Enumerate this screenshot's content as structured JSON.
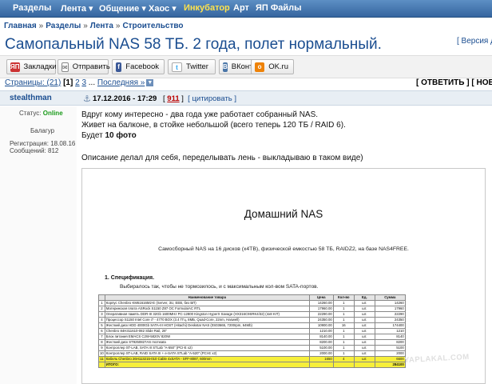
{
  "nav": {
    "items": [
      "Разделы",
      "Лента ▾",
      "Общение ▾",
      "Хаос ▾",
      "Инкубатор",
      "Арт",
      "ЯП Файлы"
    ]
  },
  "breadcrumbs": [
    "Главная",
    "Разделы",
    "Лента",
    "Строительство"
  ],
  "post_title": "Самопальный NAS 58 ТБ. 2 года, полет нормальный.",
  "print_version": "[ Версия д",
  "share": {
    "bookmarks": "Закладки",
    "send": "Отправить",
    "facebook": "Facebook",
    "twitter": "Twitter",
    "vk": "ВКонтакте",
    "ok": "OK.ru"
  },
  "pager": {
    "label": "Страницы: (21)",
    "current": "[1]",
    "p2": "2",
    "p3": "3",
    "dots": "...",
    "last": "Последняя »"
  },
  "reply_buttons": "[ ОТВЕТИТЬ ] [ НОВА",
  "post": {
    "author": "stealthman",
    "anchor_icon": "⚓",
    "date": "17.12.2016 - 17:29",
    "num_open": "[",
    "num": "911",
    "num_close": "]",
    "quote": "[ цитировать ]",
    "status_label": "Статус:",
    "status_value": "Online",
    "location": "Балагур",
    "registered": "Регистрация: 18.08.16",
    "messages": "Сообщений: 812",
    "line1": "Вдруг кому интересно - два года уже работает собранный NAS.",
    "line2": "Живет на балконе, в стойке небольшой (всего теперь 120 ТБ / RAID 6).",
    "line3_a": "Будет",
    "line3_b": "10 фото",
    "desc": "Описание делал для себя, переделывать лень - выкладываю в таком виде)"
  },
  "doc": {
    "title": "Домашний NAS",
    "subtitle": "Самосборный NAS на 16 дисков (x4TB), физической емкостью 58 ТБ, RAIDZ2, на базе NAS4FREE.",
    "spec_heading": "1.   Спецификация.",
    "spec_text": "Выбиралось так, чтобы не тормозилось, и с максимальным кол-вом SATA-портов.",
    "headers": [
      "",
      "Наименование товара",
      "Цена",
      "Кол-во",
      "Ед.",
      "Сумма"
    ],
    "rows": [
      [
        "1",
        "Корпус Chenbro KM61616M2-E (Server, 3U, EEB, без БП)",
        "14260.00",
        "1",
        "шт.",
        "14260"
      ],
      [
        "2",
        "Материнская плата ASRock S1150 Z87 OC Formula/AC RTL",
        "17960.00",
        "1",
        "шт.",
        "17960"
      ],
      [
        "3",
        "Оперативная память DDR-III 32Gb 1600MHz PC-12800 Kingston HyperX Savage (HX316C9SRK4/32) (4x8 KIT)",
        "22290.00",
        "1",
        "шт.",
        "22290"
      ],
      [
        "4",
        "Процессор S1150 Intel Core i7 - 4770 BOX (3.4 ГГц, 8МБ, Quad-Core, 22nm, Haswell)",
        "24350.00",
        "1",
        "шт.",
        "24350"
      ],
      [
        "5",
        "Жесткий диск HDD 4000Gb SATA-III HOST (Hitachi) Deskstar NAS (0S03665, 7200rpm, 64Mb)",
        "10900.00",
        "16",
        "шт.",
        "174400"
      ],
      [
        "6",
        "Chenbro 84H311610-082 Slide Rail, 26\"",
        "1210.00",
        "1",
        "шт.",
        "1210"
      ],
      [
        "7",
        "Блок питания EMACS C2W-5820V 820W",
        "8140.00",
        "1",
        "шт.",
        "8140"
      ],
      [
        "8",
        "Жесткий диск ST9250827AS mcmsata",
        "8200.00",
        "1",
        "шт.",
        "8200"
      ],
      [
        "9",
        "Контроллер ST-LAB, SATA III STLab \"A-550\" (PCI-E x2)",
        "5100.00",
        "1",
        "шт.",
        "5100"
      ],
      [
        "10",
        "Контроллер ST-LAB, RAID SATA III + e-SATA STLab \"A-520\" (PCI-E x2)",
        "2000.00",
        "1",
        "шт.",
        "2000"
      ],
      [
        "11",
        "Кабель Chenbro 26H113215-010 Cable 4xSATA - SFF-8087, 600mm",
        "1650",
        "4",
        "шт.",
        "6600"
      ]
    ],
    "total_label": "ИТОГО:",
    "total_value": "284100"
  },
  "watermark": "YAPLAKAL.COM"
}
